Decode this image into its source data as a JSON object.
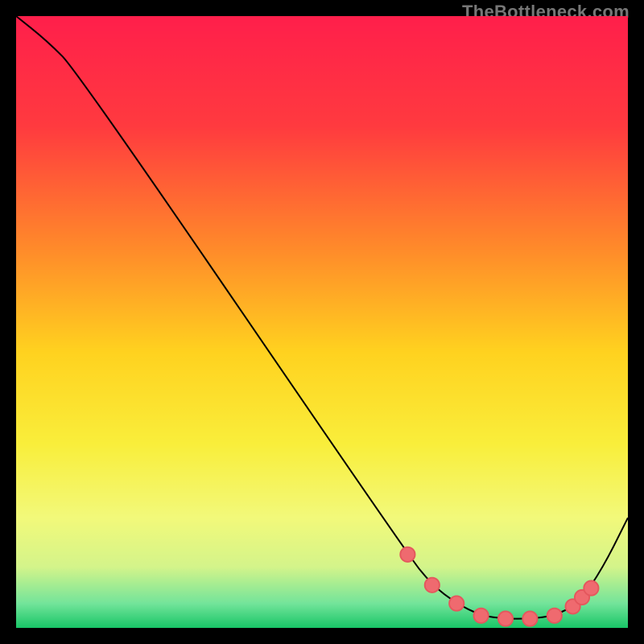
{
  "watermark": "TheBottleneck.com",
  "chart_data": {
    "type": "line",
    "title": "",
    "xlabel": "",
    "ylabel": "",
    "xlim": [
      0,
      100
    ],
    "ylim": [
      0,
      100
    ],
    "grid": false,
    "legend": false,
    "series": [
      {
        "name": "curve",
        "x": [
          0,
          5,
          10,
          64,
          68,
          72,
          76,
          80,
          84,
          88,
          92,
          96,
          100
        ],
        "values": [
          100,
          96,
          91,
          12,
          7,
          4,
          2,
          1.5,
          1.5,
          2,
          4,
          10,
          18
        ]
      }
    ],
    "markers": {
      "name": "dots",
      "x": [
        64,
        68,
        72,
        76,
        80,
        84,
        88,
        91,
        92.5,
        94
      ],
      "values": [
        12,
        7,
        4,
        2,
        1.5,
        1.5,
        2,
        3.5,
        5,
        6.5
      ]
    },
    "background_gradient": {
      "stops": [
        {
          "offset": 0.0,
          "color": "#ff1f4b"
        },
        {
          "offset": 0.18,
          "color": "#ff3a3f"
        },
        {
          "offset": 0.38,
          "color": "#ff8a2a"
        },
        {
          "offset": 0.55,
          "color": "#ffd21f"
        },
        {
          "offset": 0.7,
          "color": "#f9ee3b"
        },
        {
          "offset": 0.82,
          "color": "#f2f97a"
        },
        {
          "offset": 0.9,
          "color": "#d4f48a"
        },
        {
          "offset": 0.96,
          "color": "#73e49a"
        },
        {
          "offset": 1.0,
          "color": "#18c667"
        }
      ]
    },
    "colors": {
      "curve_stroke": "#000000",
      "marker_fill": "#ef6a6f",
      "marker_stroke": "#e4575d"
    }
  }
}
